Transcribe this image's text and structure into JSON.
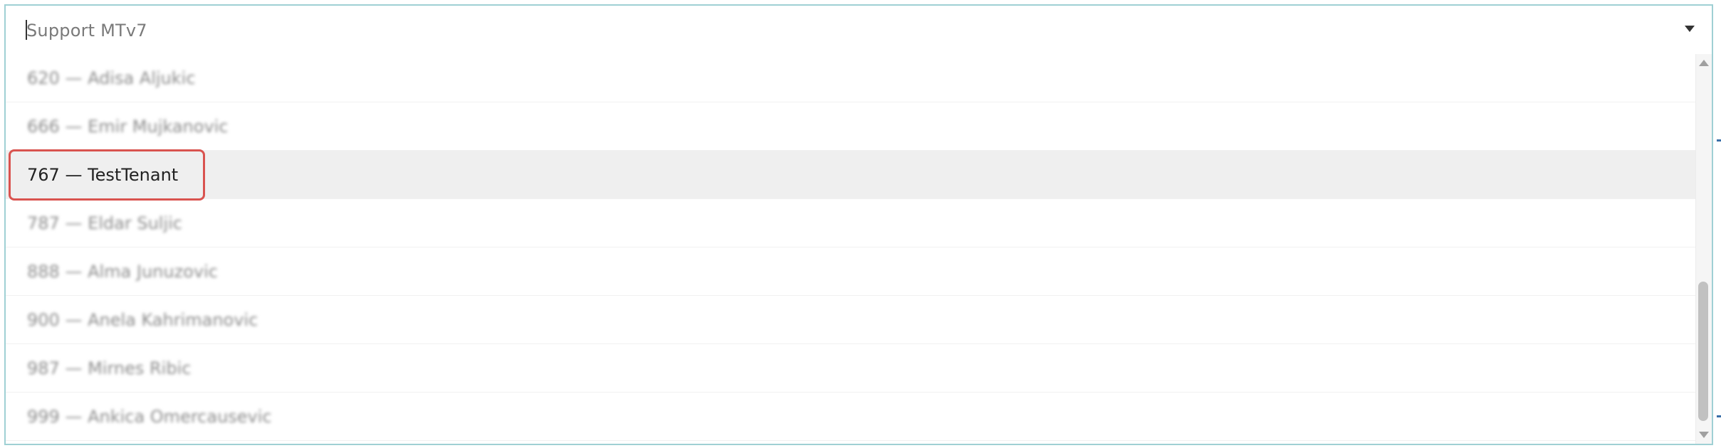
{
  "combobox": {
    "value": "Support MTv7",
    "arrow_icon": "chevron-down-icon"
  },
  "dropdown": {
    "separator": "—",
    "items": [
      {
        "id": "620",
        "name": "Adisa Aljukic",
        "blurred": true
      },
      {
        "id": "666",
        "name": "Emir Mujkanovic",
        "blurred": true
      },
      {
        "id": "767",
        "name": "TestTenant",
        "blurred": false,
        "highlighted": true
      },
      {
        "id": "787",
        "name": "Eldar Suljic",
        "blurred": true
      },
      {
        "id": "888",
        "name": "Alma Junuzovic",
        "blurred": true
      },
      {
        "id": "900",
        "name": "Anela Kahrimanovic",
        "blurred": true
      },
      {
        "id": "987",
        "name": "Mirnes Ribic",
        "blurred": true
      },
      {
        "id": "999",
        "name": "Ankica Omercausevic",
        "blurred": true
      }
    ],
    "item_labels": [
      "620 — Adisa Aljukic",
      "666 — Emir Mujkanovic",
      "767 — TestTenant",
      "787 — Eldar Suljic",
      "888 — Alma Junuzovic",
      "900 — Anela Kahrimanovic",
      "987 — Mirnes Ribic",
      "999 — Ankica Omercausevic"
    ]
  },
  "colors": {
    "border": "#9fd0d4",
    "highlight_row": "#efefef",
    "annotation": "#d9534f"
  }
}
